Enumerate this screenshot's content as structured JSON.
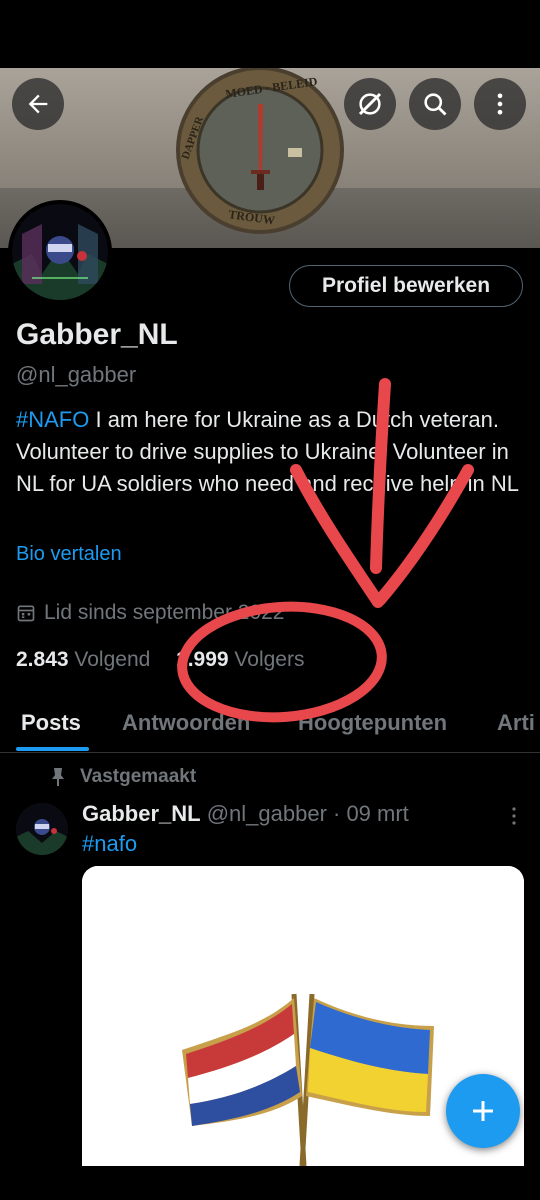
{
  "profile": {
    "display_name": "Gabber_NL",
    "handle": "@nl_gabber",
    "edit_button": "Profiel bewerken",
    "bio": {
      "hashtag": "#NAFO",
      "text": "  I am here for Ukraine as a Dutch veteran.  Volunteer to drive supplies to Ukraine.  Volunteer in NL for UA soldiers who need and receive help in NL"
    },
    "translate_bio": "Bio vertalen",
    "joined": "Lid sinds september 2022",
    "following_count": "2.843",
    "following_label": "Volgend",
    "followers_count": "1.999",
    "followers_label": "Volgers"
  },
  "banner": {
    "coin_text_top": "MOED · BELEID",
    "coin_text_bottom": "TROUW",
    "coin_text_left": "DAPPER"
  },
  "tabs": [
    {
      "label": "Posts"
    },
    {
      "label": "Antwoorden"
    },
    {
      "label": "Hoogtepunten"
    },
    {
      "label": "Arti"
    }
  ],
  "pinned_post": {
    "pinned_label": "Vastgemaakt",
    "author": "Gabber_NL",
    "meta": " @nl_gabber · 09 mrt",
    "text": "#nafo"
  },
  "icons": {
    "back": "back-arrow-icon",
    "grok": "grok-icon",
    "search": "search-icon",
    "more": "more-vertical-icon",
    "calendar": "calendar-icon",
    "pin": "pin-icon",
    "compose": "plus-icon"
  },
  "colors": {
    "accent": "#1d9bf0",
    "secondary_text": "#71767b",
    "annotation": "#e8474b"
  }
}
